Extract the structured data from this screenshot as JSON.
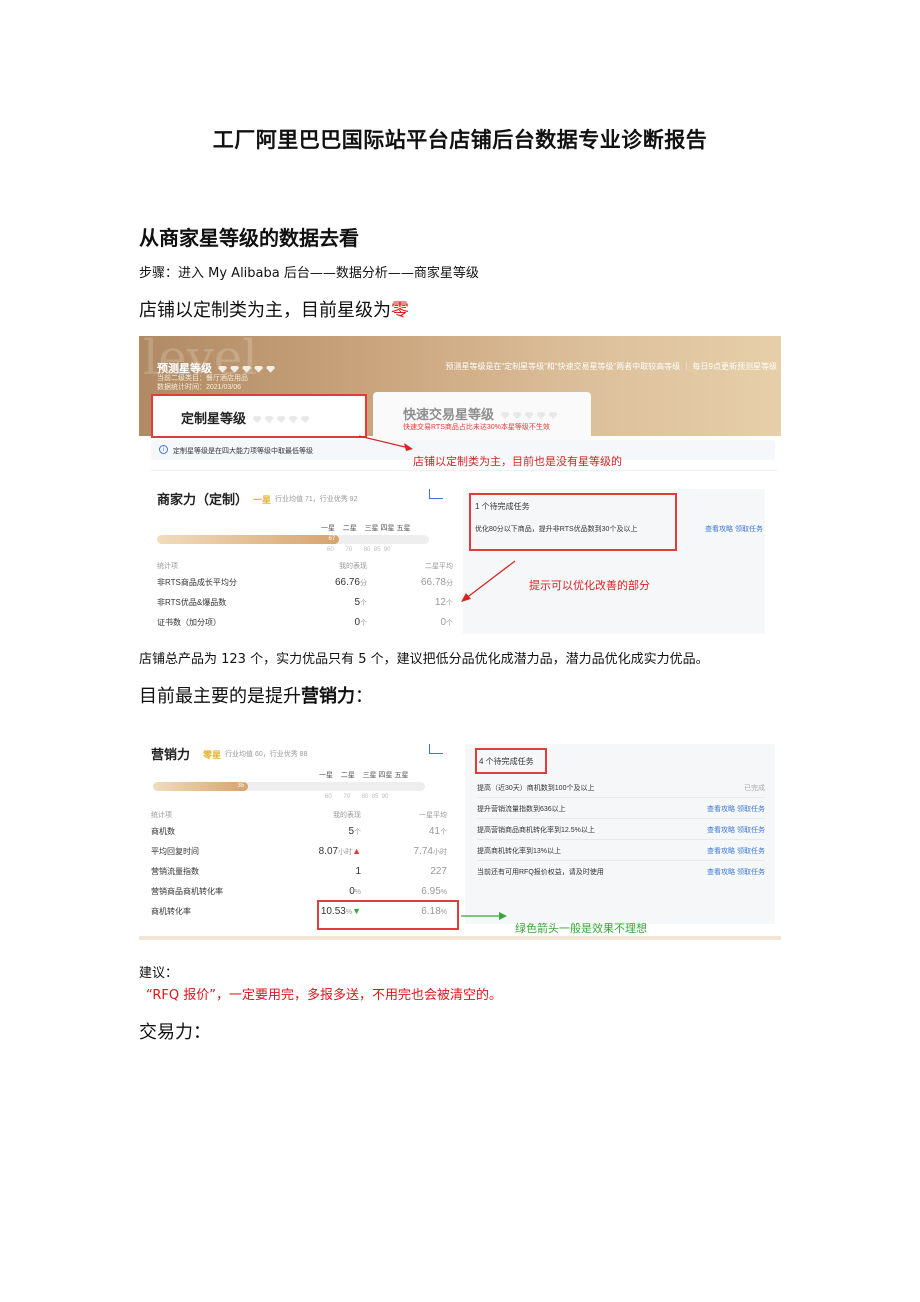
{
  "doc": {
    "title": "工厂阿里巴巴国际站平台店铺后台数据专业诊断报告",
    "section_heading": "从商家星等级的数据去看",
    "step_text": "步骤：进入 My Alibaba 后台——数据分析——商家星等级",
    "line1_prefix": "店铺以定制类为主，目前星级为",
    "line1_emph": "零",
    "para2": "店铺总产品为 123 个，实力优品只有 5 个，建议把低分品优化成潜力品，潜力品优化成实力优品。",
    "line3_prefix": "目前最主要的是提升",
    "line3_emph": "营销力",
    "line3_suffix": "：",
    "advice_label": "建议：",
    "advice_text": "“RFQ 报价”，一定要用完，多报多送，不用完也会被清空的。",
    "line4": "交易力："
  },
  "shot1": {
    "watermark": "level",
    "banner_title": "预测星等级",
    "banner_sub1": "当前二级类目：餐厅酒店用品",
    "banner_sub2": "数据统计时间：2021/03/06",
    "banner_right": "预测星等级是在“定制星等级”和“快速交易星等级”两者中取较高等级  ｜ 每日9点更新预测星等级",
    "tab_custom": "定制星等级",
    "tab_quick": "快速交易星等级",
    "tab_quick_note": "快速交易RTS商品占比未达30%本星等级不生效",
    "info_icon": "i",
    "info_text": "定制星等级是在四大能力项等级中取最低等级",
    "annotation_top": "店铺以定制类为主，目前也是没有星等级的",
    "panel_title": "商家力（定制）",
    "panel_star": "一星",
    "panel_avg": "行业均值 71，行业优秀 92",
    "levels": [
      "一星",
      "二星",
      "三星",
      "四星",
      "五星"
    ],
    "progress": 67,
    "progress_label": "67",
    "ticks": [
      "60",
      "70",
      "80",
      "85",
      "90"
    ],
    "header": {
      "item": "统计项",
      "mine": "我的表现",
      "target": "二星平均"
    },
    "rows": [
      {
        "label": "非RTS商品成长平均分",
        "mine": "66.76",
        "mine_unit": "分",
        "target": "66.78",
        "target_unit": "分"
      },
      {
        "label": "非RTS优品&爆品数",
        "mine": "5",
        "mine_unit": "个",
        "target": "12",
        "target_unit": "个"
      },
      {
        "label": "证书数（加分项）",
        "mine": "0",
        "mine_unit": "个",
        "target": "0",
        "target_unit": "个"
      }
    ],
    "task_count": "1 个待完成任务",
    "tasks": [
      {
        "label": "优化80分以下商品，提升非RTS优品数到30个及以上",
        "action": "查看攻略  领取任务"
      }
    ],
    "annotation_bottom": "提示可以优化改善的部分"
  },
  "shot2": {
    "panel_title": "营销力",
    "panel_star": "零星",
    "panel_avg": "行业均值 60，行业优秀 88",
    "levels": [
      "一星",
      "二星",
      "三星",
      "四星",
      "五星"
    ],
    "progress": 35,
    "progress_label": "35",
    "ticks": [
      "60",
      "70",
      "80",
      "85",
      "90"
    ],
    "header": {
      "item": "统计项",
      "mine": "我的表现",
      "target": "一星平均"
    },
    "rows": [
      {
        "label": "商机数",
        "mine": "5",
        "mine_unit": "个",
        "target": "41",
        "target_unit": "个",
        "trend": ""
      },
      {
        "label": "平均回复时间",
        "mine": "8.07",
        "mine_unit": "小时",
        "target": "7.74",
        "target_unit": "小时",
        "trend": "up"
      },
      {
        "label": "营销流量指数",
        "mine": "1",
        "mine_unit": "",
        "target": "227",
        "target_unit": "",
        "trend": ""
      },
      {
        "label": "营销商品商机转化率",
        "mine": "0",
        "mine_unit": "%",
        "target": "6.95",
        "target_unit": "%",
        "trend": ""
      },
      {
        "label": "商机转化率",
        "mine": "10.53",
        "mine_unit": "%",
        "target": "6.18",
        "target_unit": "%",
        "trend": "down"
      }
    ],
    "task_count": "4 个待完成任务",
    "tasks": [
      {
        "label": "提高（近30天）商机数到100个及以上",
        "action": "已完成",
        "done": true
      },
      {
        "label": "提升营销流量指数到636以上",
        "action": "查看攻略  领取任务"
      },
      {
        "label": "提高营销商品商机转化率到12.5%以上",
        "action": "查看攻略  领取任务"
      },
      {
        "label": "提高商机转化率到13%以上",
        "action": "查看攻略  领取任务"
      },
      {
        "label": "当前还有可用RFQ报价权益，请及时使用",
        "action": "查看攻略  领取任务"
      }
    ],
    "annotation": "绿色箭头一般是效果不理想"
  },
  "colors": {
    "accent_red": "#e0161b",
    "link_blue": "#3a78d8",
    "gold": "#e7b634",
    "green": "#3aa53a"
  }
}
